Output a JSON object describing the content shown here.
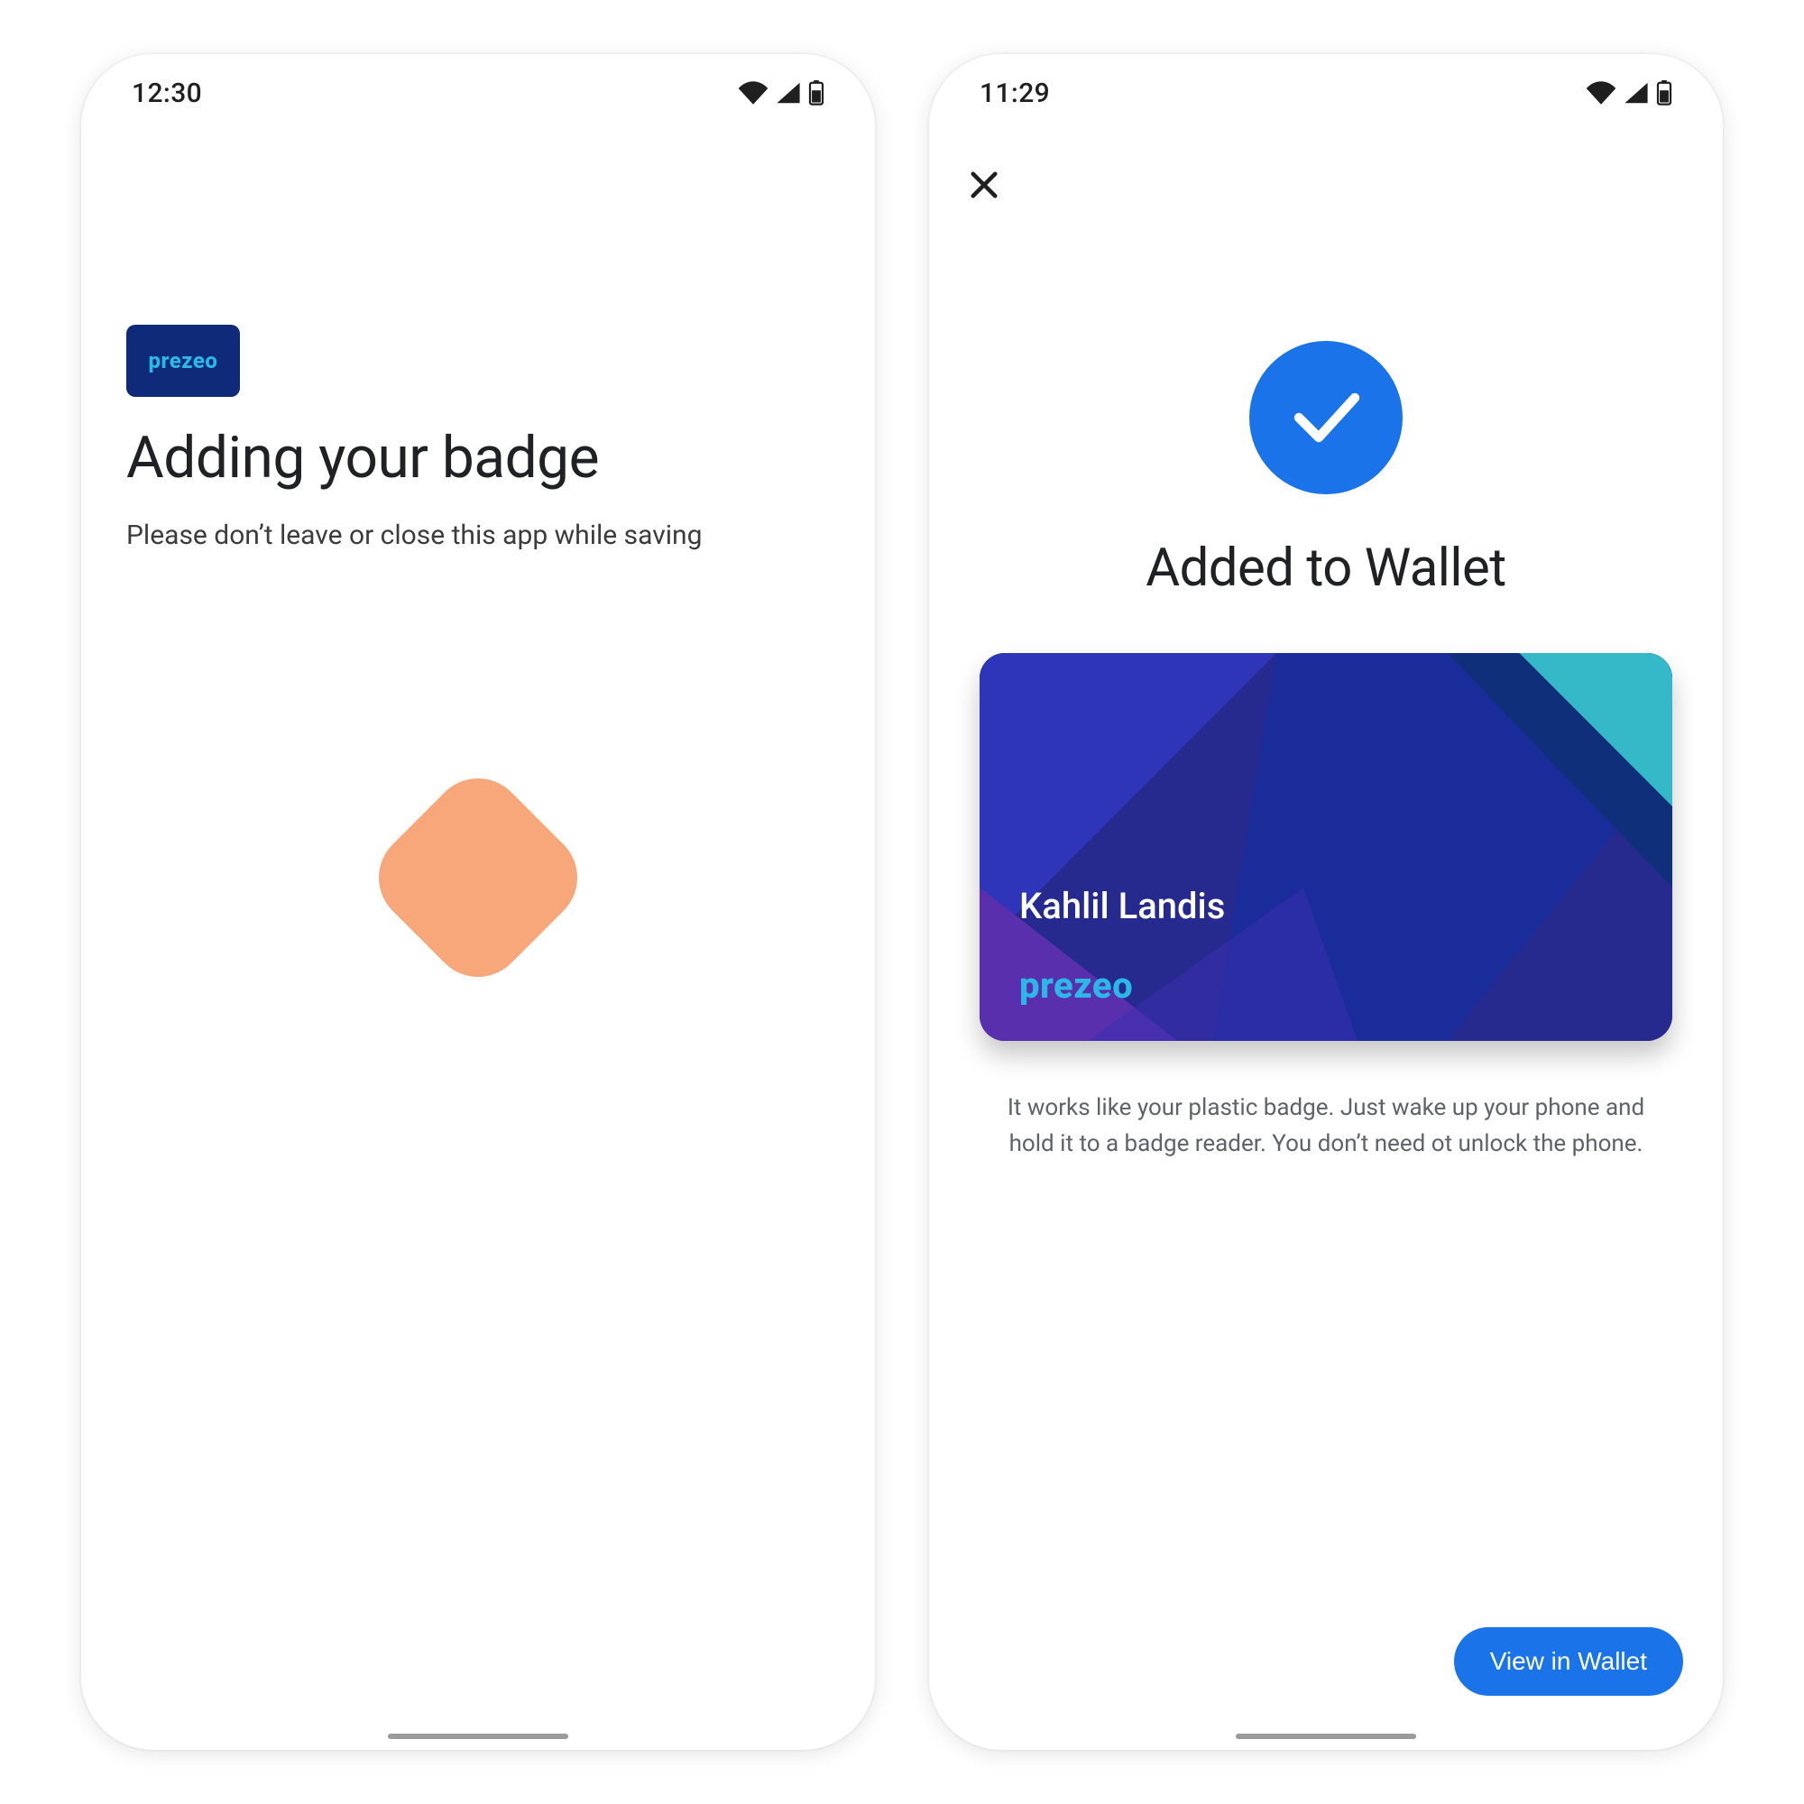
{
  "brand": {
    "name": "prezeo",
    "accent": "#2bb8e6",
    "chip_bg": "#0e2a78"
  },
  "left": {
    "status_time": "12:30",
    "title": "Adding your badge",
    "subtitle": "Please don’t leave or close this app while saving",
    "spinner_color": "#f7a77a"
  },
  "right": {
    "status_time": "11:29",
    "title": "Added to Wallet",
    "card": {
      "holder_name": "Kahlil Landis",
      "brand_label": "prezeo"
    },
    "help_text": "It works like your plastic badge. Just wake up your phone and hold it to a badge reader. You don’t need ot unlock the phone.",
    "cta_label": "View in Wallet",
    "accent": "#1a73e8"
  }
}
